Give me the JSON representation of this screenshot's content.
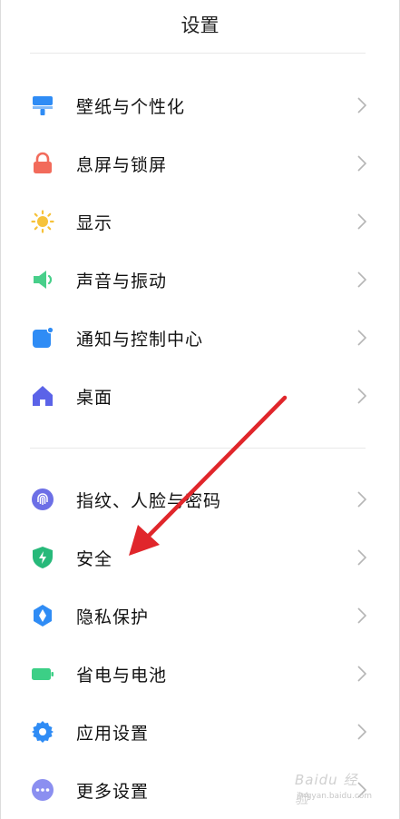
{
  "header": {
    "title": "设置"
  },
  "groups": [
    {
      "items": [
        {
          "label": "壁纸与个性化",
          "icon": "wallpaper-icon",
          "color": "#2f8cf5"
        },
        {
          "label": "息屏与锁屏",
          "icon": "lock-icon",
          "color": "#f26b5b"
        },
        {
          "label": "显示",
          "icon": "sun-icon",
          "color": "#f6c23a"
        },
        {
          "label": "声音与振动",
          "icon": "speaker-icon",
          "color": "#48cf8a"
        },
        {
          "label": "通知与控制中心",
          "icon": "notification-icon",
          "color": "#2f8cf5"
        },
        {
          "label": "桌面",
          "icon": "home-icon",
          "color": "#5b63e8"
        }
      ]
    },
    {
      "items": [
        {
          "label": "指纹、人脸与密码",
          "icon": "fingerprint-icon",
          "color": "#6c6fe6"
        },
        {
          "label": "安全",
          "icon": "shield-icon",
          "color": "#27b97a"
        },
        {
          "label": "隐私保护",
          "icon": "privacy-icon",
          "color": "#2f8cf5"
        },
        {
          "label": "省电与电池",
          "icon": "battery-icon",
          "color": "#3ccf86"
        },
        {
          "label": "应用设置",
          "icon": "gear-icon",
          "color": "#2f8cf5"
        },
        {
          "label": "更多设置",
          "icon": "more-icon",
          "color": "#8b8ff0"
        }
      ]
    }
  ],
  "watermark": {
    "text": "Baidu 经验",
    "sub": "jingyan.baidu.com"
  },
  "colors": {
    "arrow": "#e0262b",
    "chevron": "#b5b5b5"
  }
}
